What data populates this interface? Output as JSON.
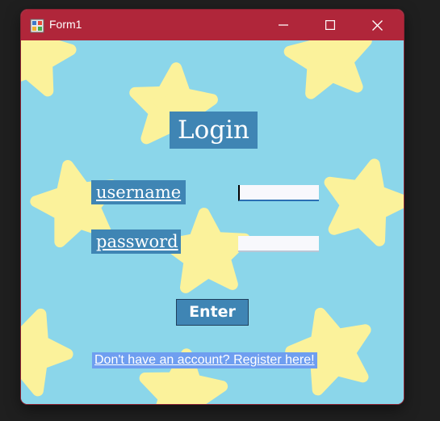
{
  "window": {
    "title": "Form1",
    "titlebar_color": "#b0263a",
    "background_color": "#8bd6ea",
    "controls": [
      "minimize-icon",
      "maximize-icon",
      "close-icon"
    ]
  },
  "form": {
    "heading": "Login",
    "username_label": "username",
    "password_label": "password",
    "username_value": "",
    "password_value": "",
    "enter_label": "Enter",
    "register_link": "Don't have an account? Register here!",
    "accent_color": "#3f85b4",
    "link_bg_color": "#6f9ef0",
    "star_color": "#fbf29b"
  }
}
